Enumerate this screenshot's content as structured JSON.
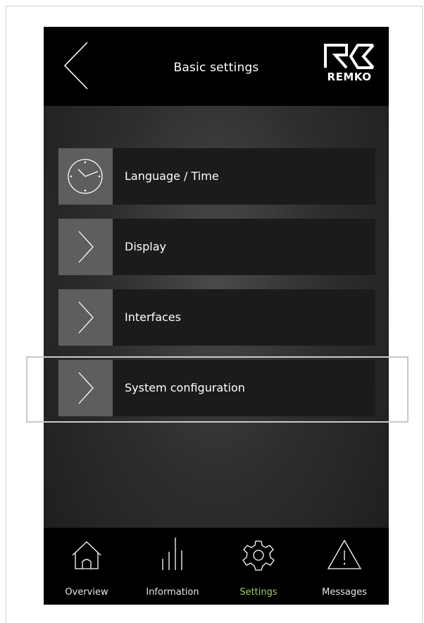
{
  "header": {
    "title": "Basic settings",
    "logo_text": "REMKO",
    "back_icon": "chevron-left-icon"
  },
  "menu": {
    "items": [
      {
        "label": "Language / Time",
        "icon": "clock-icon"
      },
      {
        "label": "Display",
        "icon": "chevron-right-icon"
      },
      {
        "label": "Interfaces",
        "icon": "chevron-right-icon"
      },
      {
        "label": "System configuration",
        "icon": "chevron-right-icon"
      }
    ],
    "highlighted_item": "System configuration"
  },
  "footer": {
    "nav": [
      {
        "label": "Overview",
        "icon": "home-icon",
        "active": false
      },
      {
        "label": "Information",
        "icon": "bars-icon",
        "active": false
      },
      {
        "label": "Settings",
        "icon": "gear-icon",
        "active": true
      },
      {
        "label": "Messages",
        "icon": "warning-icon",
        "active": false
      }
    ]
  },
  "colors": {
    "active_nav": "#9bd16a",
    "icon_box": "#5e5e5e",
    "menu_bg": "#1b1b1b",
    "header_bg": "#000000"
  }
}
